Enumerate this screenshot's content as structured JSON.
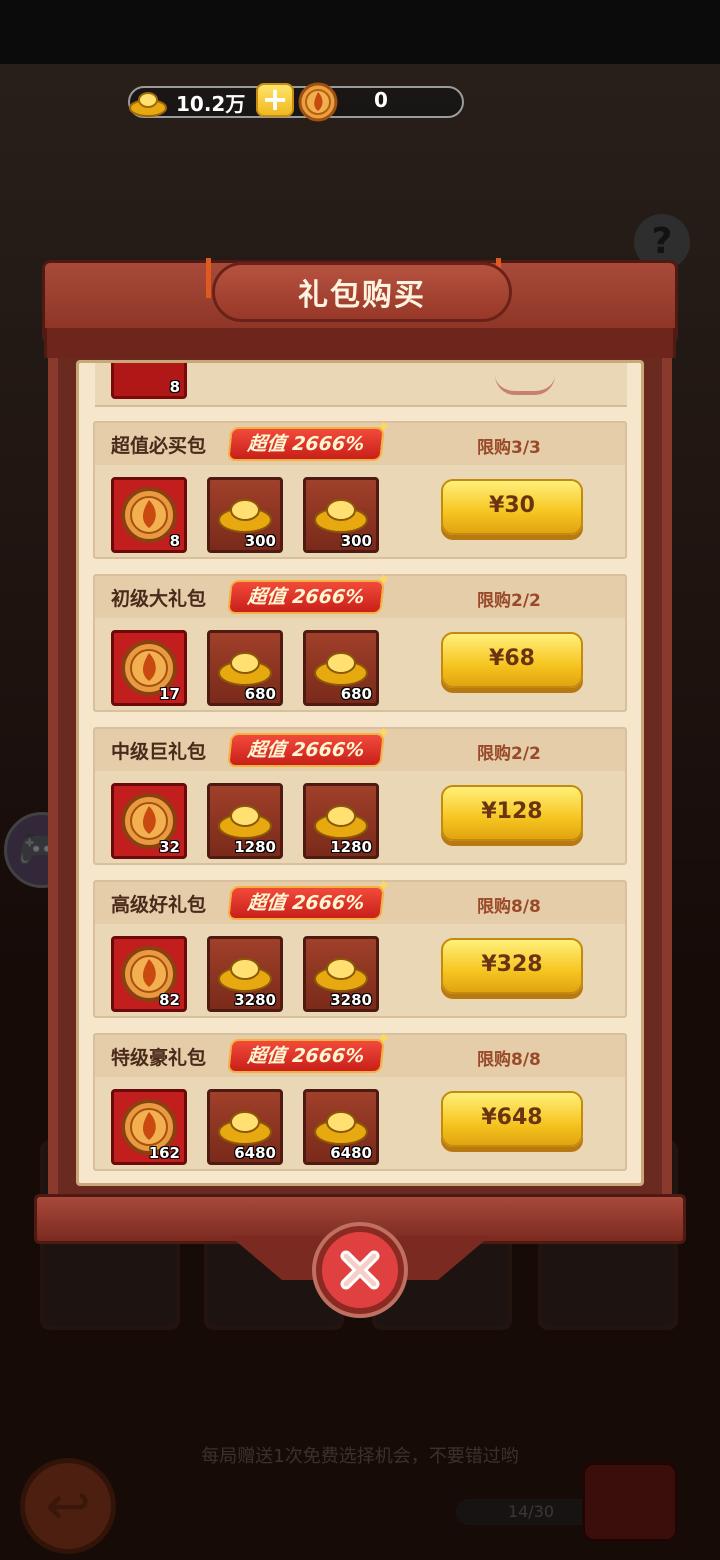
{
  "currency": {
    "gold": "10.2万",
    "tokens": "0"
  },
  "background": {
    "hint": "每局赠送1次免费选择机会，不要错过哟",
    "progress": "14/30",
    "help": "?"
  },
  "dialog": {
    "title": "礼包购买",
    "packs": [
      {
        "name": "超值必买包",
        "badge": "超值 2666%",
        "limit": "限购3/3",
        "price": "¥30",
        "items": [
          "8",
          "300",
          "300"
        ]
      },
      {
        "name": "初级大礼包",
        "badge": "超值 2666%",
        "limit": "限购2/2",
        "price": "¥68",
        "items": [
          "17",
          "680",
          "680"
        ]
      },
      {
        "name": "中级巨礼包",
        "badge": "超值 2666%",
        "limit": "限购2/2",
        "price": "¥128",
        "items": [
          "32",
          "1280",
          "1280"
        ]
      },
      {
        "name": "高级好礼包",
        "badge": "超值 2666%",
        "limit": "限购8/8",
        "price": "¥328",
        "items": [
          "82",
          "3280",
          "3280"
        ]
      },
      {
        "name": "特级豪礼包",
        "badge": "超值 2666%",
        "limit": "限购8/8",
        "price": "¥648",
        "items": [
          "162",
          "6480",
          "6480"
        ]
      }
    ],
    "partial_item_count": "8"
  },
  "icons": {
    "coin": "flame-coin-icon",
    "ingot": "gold-ingot-icon",
    "close": "close-icon",
    "plus": "plus-icon"
  },
  "colors": {
    "accent_gold": "#f6c520",
    "badge_red": "#d8261e",
    "panel": "#f5e6cc"
  }
}
